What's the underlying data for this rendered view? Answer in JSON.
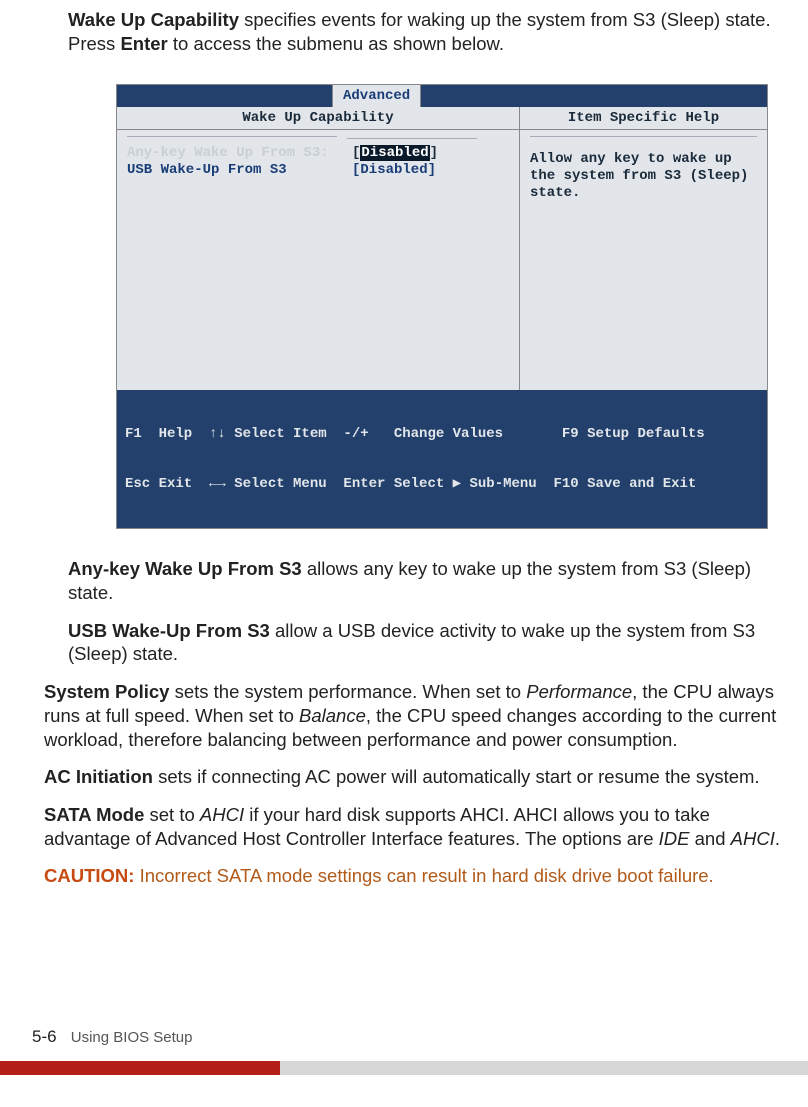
{
  "intro": {
    "bold1": "Wake Up Capability",
    "text1": "  specifies events for waking up the system from S3 (Sleep) state. Press ",
    "bold2": "Enter",
    "text2": " to access the submenu as shown below."
  },
  "bios": {
    "tab": "Advanced",
    "header_left": "Wake Up Capability",
    "header_right": "Item Specific Help",
    "options": [
      {
        "label": "Any-key Wake Up From S3:",
        "value": "Disabled",
        "selected": true
      },
      {
        "label": "USB Wake-Up From S3",
        "value": "[Disabled]",
        "selected": false
      }
    ],
    "help": "Allow any key to wake up the system from S3 (Sleep) state.",
    "footer": {
      "line1": "F1  Help  ↑↓ Select Item  -/+   Change Values       F9 Setup Defaults",
      "line2": "Esc Exit  ←→ Select Menu  Enter Select ▶ Sub-Menu  F10 Save and Exit"
    }
  },
  "para1": {
    "bold": "Any-key Wake Up From S3",
    "rest": "  allows any key to wake up the system from S3 (Sleep) state."
  },
  "para2": {
    "bold": "USB Wake-Up From S3",
    "rest": "  allow a USB device activity to wake up the system from S3 (Sleep) state."
  },
  "para3": {
    "bold": "System Policy",
    "t1": " sets the system performance. When set to ",
    "em1": "Performance",
    "t2": ", the CPU always runs at full speed. When set to ",
    "em2": "Balance",
    "t3": ", the CPU speed changes according to the current workload, therefore balancing between performance and power consumption."
  },
  "para4": {
    "bold": "AC Initiation",
    "rest": " sets if connecting AC power will automatically start or resume the system."
  },
  "para5": {
    "bold": "SATA Mode",
    "t1": "  set to ",
    "em1": "AHCI",
    "t2": " if your hard disk supports AHCI. AHCI allows you to take advantage of Advanced Host Controller Interface features. The options are ",
    "em2": "IDE",
    "t3": " and ",
    "em3": "AHCI",
    "t4": "."
  },
  "caution": {
    "label": "CAUTION:",
    "text": " Incorrect SATA mode settings can result in hard disk drive boot failure."
  },
  "footer": {
    "page": "5-6",
    "title": "Using BIOS Setup"
  }
}
